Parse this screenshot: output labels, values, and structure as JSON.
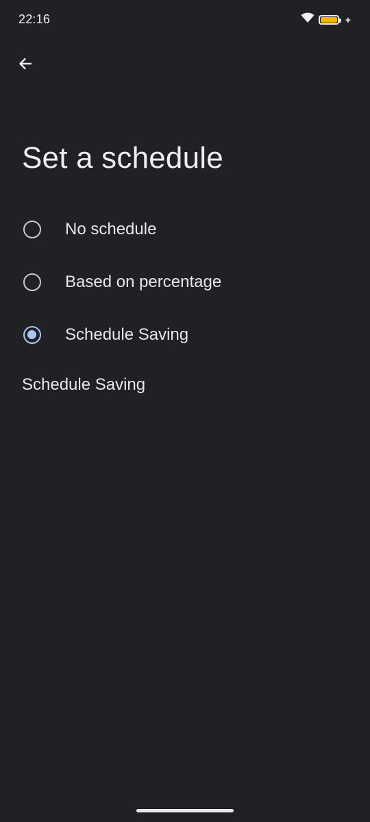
{
  "status_bar": {
    "time": "22:16",
    "battery_color": "#f4b400"
  },
  "page": {
    "title": "Set a schedule"
  },
  "options": [
    {
      "label": "No schedule",
      "checked": false
    },
    {
      "label": "Based on percentage",
      "checked": false
    },
    {
      "label": "Schedule Saving",
      "checked": true
    }
  ],
  "section": {
    "label": "Schedule Saving"
  },
  "colors": {
    "background": "#1f2124",
    "accent": "#a8c8fb"
  }
}
